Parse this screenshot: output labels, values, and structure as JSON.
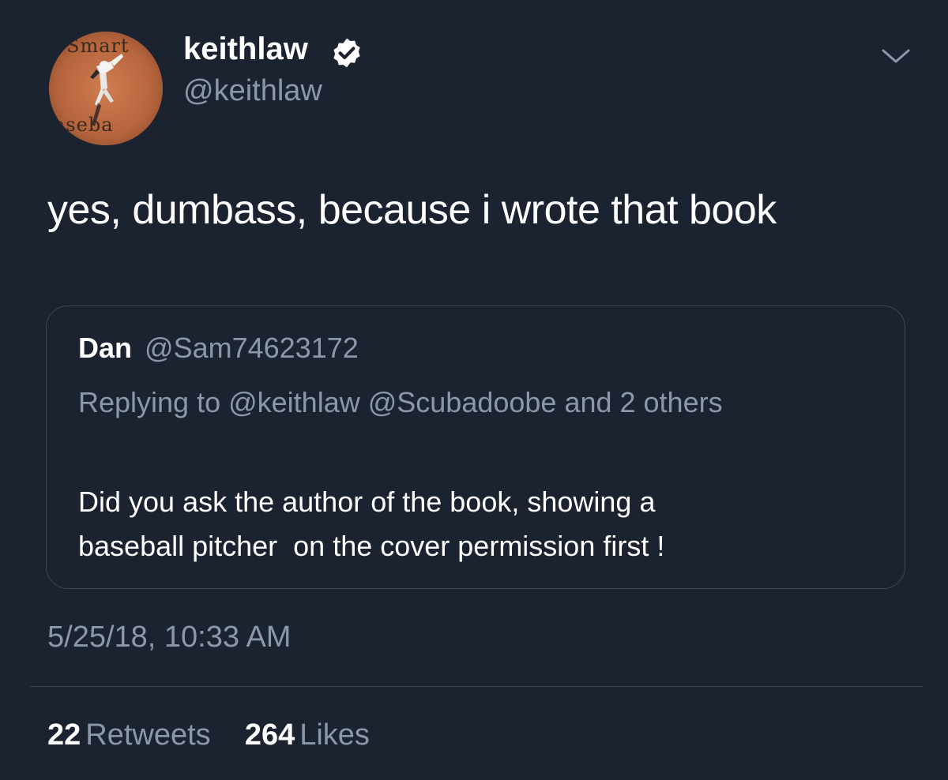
{
  "author": {
    "display_name": "keithlaw",
    "handle": "@keithlaw",
    "avatar_text_top": "Smart",
    "avatar_text_bottom": "Baseball",
    "avatar_text_bottom_visible": "aseba"
  },
  "icons": {
    "verified": "verified-badge-icon",
    "menu": "chevron-down-icon"
  },
  "tweet": {
    "text": "yes, dumbass, because i wrote that book"
  },
  "quoted_tweet": {
    "name": "Dan",
    "handle": "@Sam74623172",
    "reply_context": "Replying to @keithlaw @Scubadoobe and 2 others",
    "text": "Did you ask the author of the book, showing a\nbaseball pitcher  on the cover permission first !"
  },
  "timestamp": "5/25/18, 10:33 AM",
  "stats": {
    "retweets_count": "22",
    "retweets_label": "Retweets",
    "likes_count": "264",
    "likes_label": "Likes"
  },
  "colors": {
    "background": "#1b2230",
    "secondary_text": "#8b98a8",
    "border": "#3d4857"
  }
}
